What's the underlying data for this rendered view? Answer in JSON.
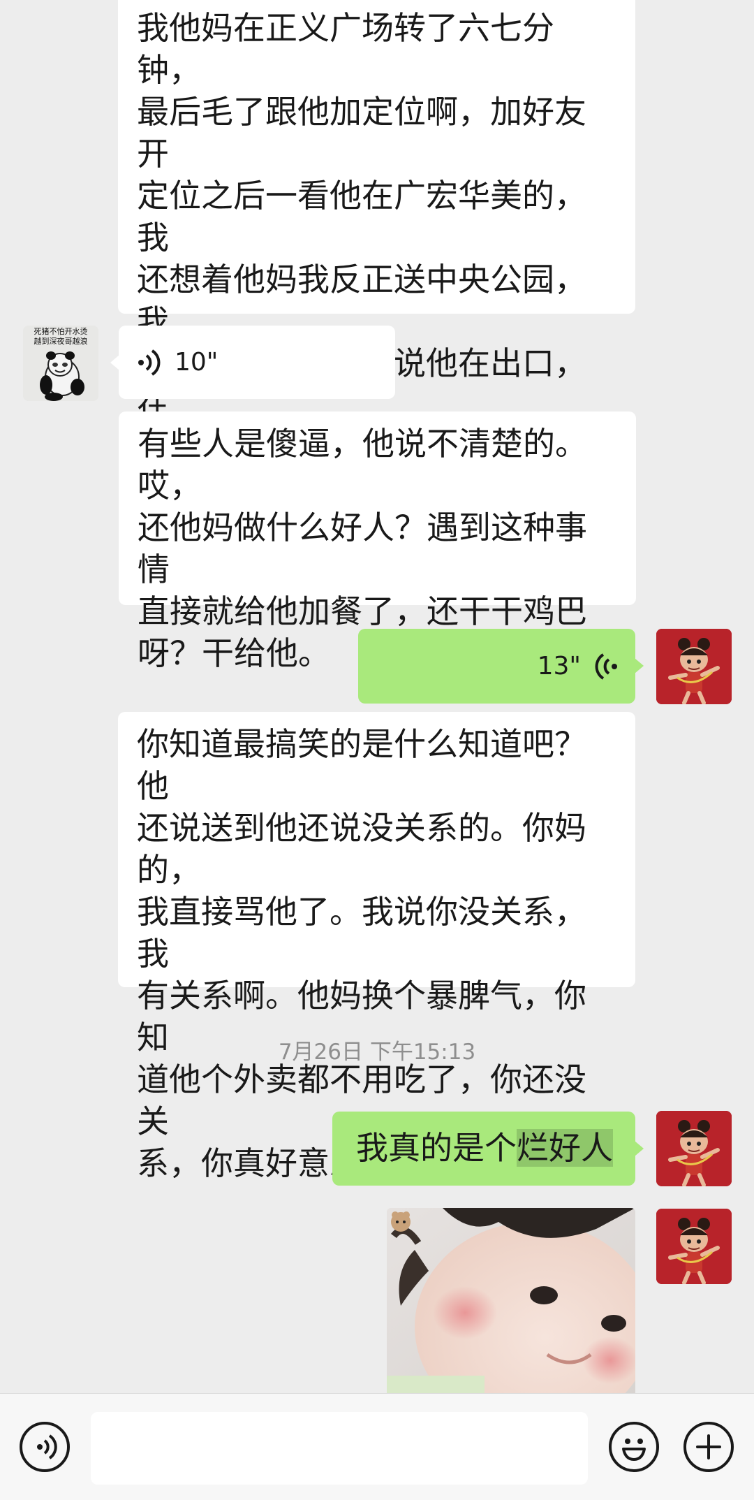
{
  "messages": {
    "m1_text": "我他妈在正义广场转了六七分钟，\n最后毛了跟他加定位啊，加好友开\n定位之后一看他在广宏华美的，我\n还想着他妈我反正送中央公园，我\n给他送过去吧。他说他在出口，在\n地面等着。你妈逼的，他妈送到他\n人还在下面，我操他妈。",
    "m2_voice_duration": "10\"",
    "m3_text": "有些人是傻逼，他说不清楚的。哎，\n还他妈做什么好人？遇到这种事情\n直接就给他加餐了，还干干鸡巴\n呀？干给他。",
    "m4_voice_duration": "13\"",
    "m5_text": "你知道最搞笑的是什么知道吧？他\n还说送到他还说没关系的。你妈的，\n我直接骂他了。我说你没关系，我\n有关系啊。他妈换个暴脾气，你知\n道他个外卖都不用吃了，你还没关\n系，你真好意思。",
    "timestamp": "7月26日 下午15:13",
    "m6_text_prefix": "我真的是个",
    "m6_text_highlight": "烂好人"
  },
  "sticker_avatar": {
    "line1": "死猪不怕开水烫",
    "line2": "越到深夜哥越浪"
  },
  "icons": {
    "voice_toggle": "voice-icon",
    "emoji": "emoji-icon",
    "plus": "plus-icon"
  },
  "colors": {
    "background": "#ededed",
    "outgoing_bubble": "#a9e97c",
    "incoming_bubble": "#ffffff",
    "avatar_red": "#b8232a"
  }
}
